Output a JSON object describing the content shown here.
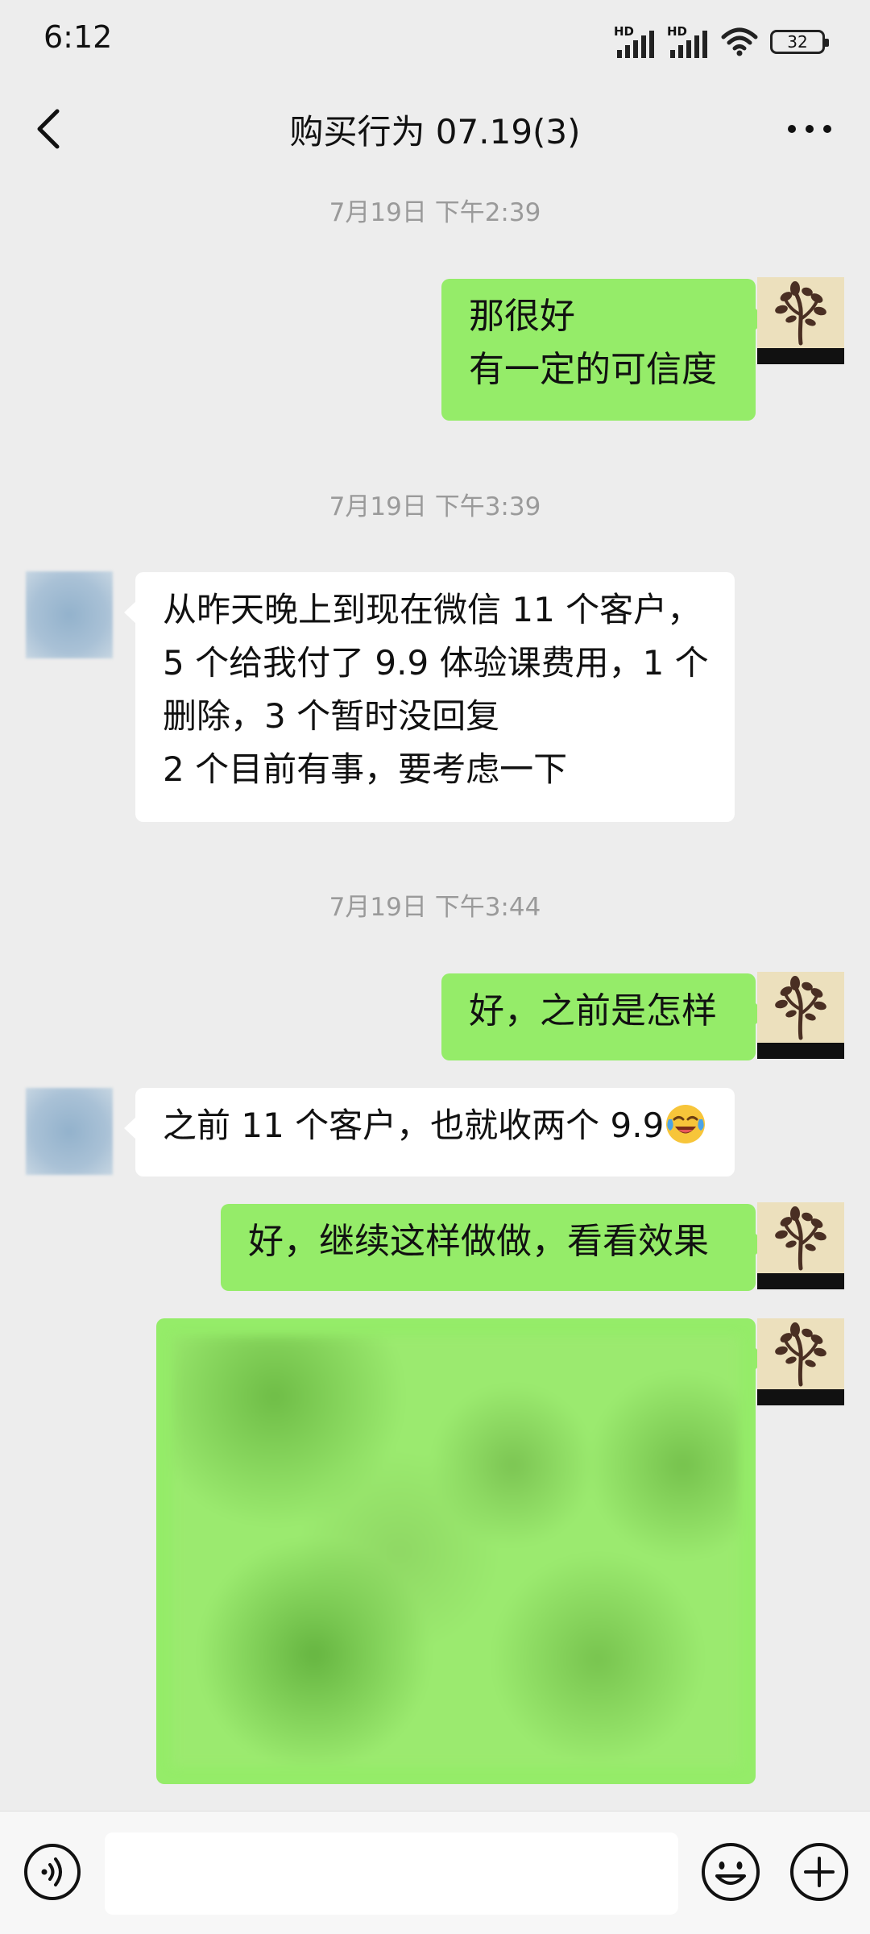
{
  "status_bar": {
    "time": "6:12",
    "signal_1_label": "HD",
    "signal_2_label": "HD",
    "battery": "32"
  },
  "header": {
    "title": "购买行为 07.19(3)"
  },
  "messages": {
    "ts1": "7月19日 下午2:39",
    "m1": {
      "line1": "那很好",
      "line2": "有一定的可信度"
    },
    "ts2": "7月19日 下午3:39",
    "m2": {
      "line1": "从昨天晚上到现在微信 11 个客户，",
      "line2": "5 个给我付了 9.9 体验课费用，1 个",
      "line3": "删除，3 个暂时没回复",
      "line4": "2 个目前有事，要考虑一下"
    },
    "ts3": "7月19日 下午3:44",
    "m3": "好，之前是怎样",
    "m4": "之前 11 个客户，也就收两个 9.9",
    "m4_emoji": "laughing-crying-emoji",
    "m5": "好，继续这样做做，看看效果"
  },
  "input": {
    "value": "",
    "placeholder": ""
  },
  "colors": {
    "background": "#ededed",
    "my_bubble": "#95ec69",
    "other_bubble": "#ffffff",
    "timestamp": "#9a9a9a"
  }
}
